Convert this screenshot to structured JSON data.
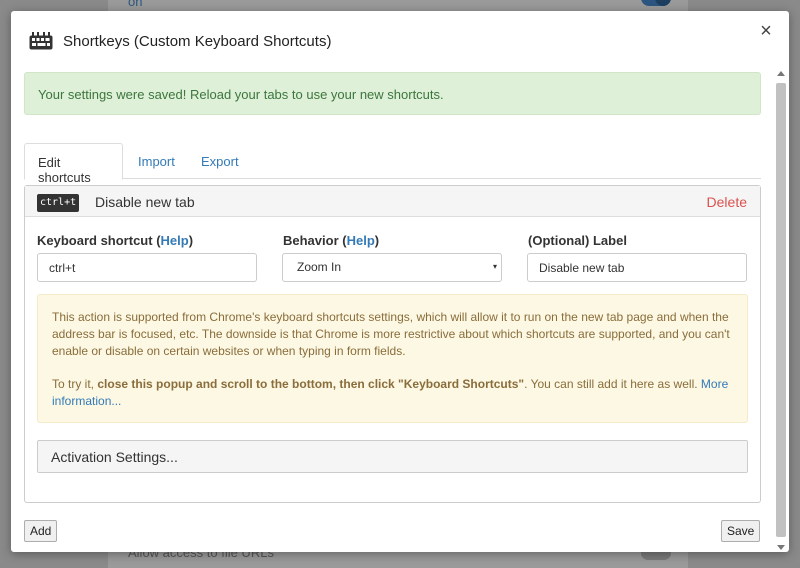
{
  "background": {
    "top_text": "on",
    "bottom_text": "Allow access to file URLs"
  },
  "dialog": {
    "title": "Shortkeys (Custom Keyboard Shortcuts)",
    "close_glyph": "×"
  },
  "alert": {
    "text": "Your settings were saved! Reload your tabs to use your new shortcuts."
  },
  "tabs": [
    {
      "label": "Edit shortcuts",
      "active": true
    },
    {
      "label": "Import",
      "active": false
    },
    {
      "label": "Export",
      "active": false
    }
  ],
  "shortcut": {
    "key_badge": "ctrl+t",
    "label": "Disable new tab",
    "delete_label": "Delete",
    "fields": {
      "keyboard_shortcut": {
        "label": "Keyboard shortcut",
        "help": "Help",
        "value": "ctrl+t"
      },
      "behavior": {
        "label": "Behavior",
        "help": "Help",
        "value": "Zoom In"
      },
      "label": {
        "label": "(Optional) Label",
        "value": "Disable new tab"
      }
    },
    "warning": {
      "paragraph1": "This action is supported from Chrome's keyboard shortcuts settings, which will allow it to run on the new tab page and when the address bar is focused, etc. The downside is that Chrome is more restrictive about which shortcuts are supported, and you can't enable or disable on certain websites or when typing in form fields.",
      "p2_prefix": "To try it,",
      "p2_bold": "close this popup and scroll to the bottom, then click \"Keyboard Shortcuts\"",
      "p2_suffix": ". You can still add it here as well.",
      "p2_link": "More information..."
    },
    "activation_label": "Activation Settings..."
  },
  "footer": {
    "add_label": "Add",
    "save_label": "Save"
  },
  "icons": {
    "app": "keyboard-icon",
    "close": "close-icon",
    "caret": "▾"
  },
  "colors": {
    "link": "#337ab7",
    "delete": "#d9534f",
    "success_bg": "#dff0d8",
    "success_text": "#3c763d",
    "warning_bg": "#fcf8e3",
    "warning_text": "#8a6d3b"
  }
}
